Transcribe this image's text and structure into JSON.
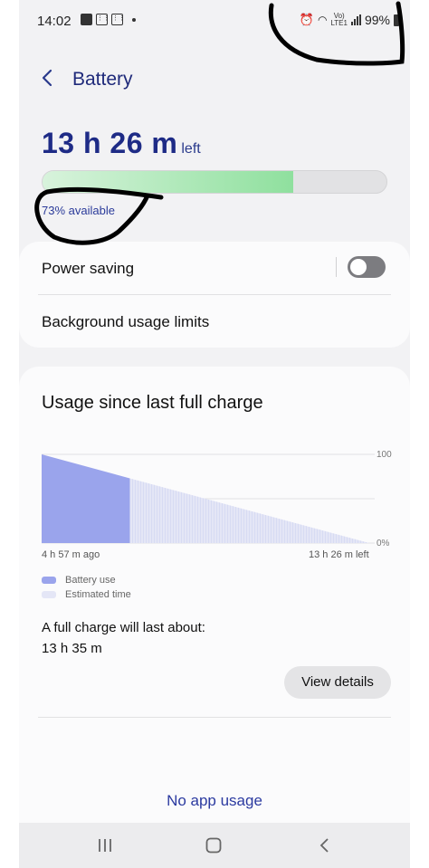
{
  "status_bar": {
    "time": "14:02",
    "network_top": "Vo)",
    "network_bottom": "LTE1",
    "battery_percent": "99%"
  },
  "header": {
    "title": "Battery"
  },
  "summary": {
    "time_left": "13 h 26 m",
    "left_label": "left",
    "available": "73% available",
    "level": 0.73,
    "bar_color": "#8fe09e"
  },
  "settings": {
    "power_saving_label": "Power saving",
    "power_saving_on": false,
    "background_limits_label": "Background usage limits"
  },
  "usage": {
    "title": "Usage since last full charge",
    "legend": [
      "Battery use",
      "Estimated time"
    ],
    "full_charge_label": "A full charge will last about:",
    "full_charge_value": "13 h 35 m",
    "view_details": "View details",
    "no_app_usage": "No app usage"
  },
  "chart_data": {
    "type": "area",
    "y_tick_labels": [
      "100",
      "0%"
    ],
    "x_tick_labels": [
      "4 h 57 m ago",
      "13 h 26 m left"
    ],
    "ylim": [
      0,
      100
    ],
    "series": [
      {
        "name": "Battery use",
        "x": [
          0,
          4.95
        ],
        "y": [
          100,
          73
        ],
        "color": "#9aa4ec"
      },
      {
        "name": "Estimated time",
        "x": [
          4.95,
          18.38
        ],
        "y": [
          73,
          0
        ],
        "color": "#e4e6f6"
      }
    ],
    "x_range": [
      0,
      18.38
    ],
    "grid": true
  }
}
